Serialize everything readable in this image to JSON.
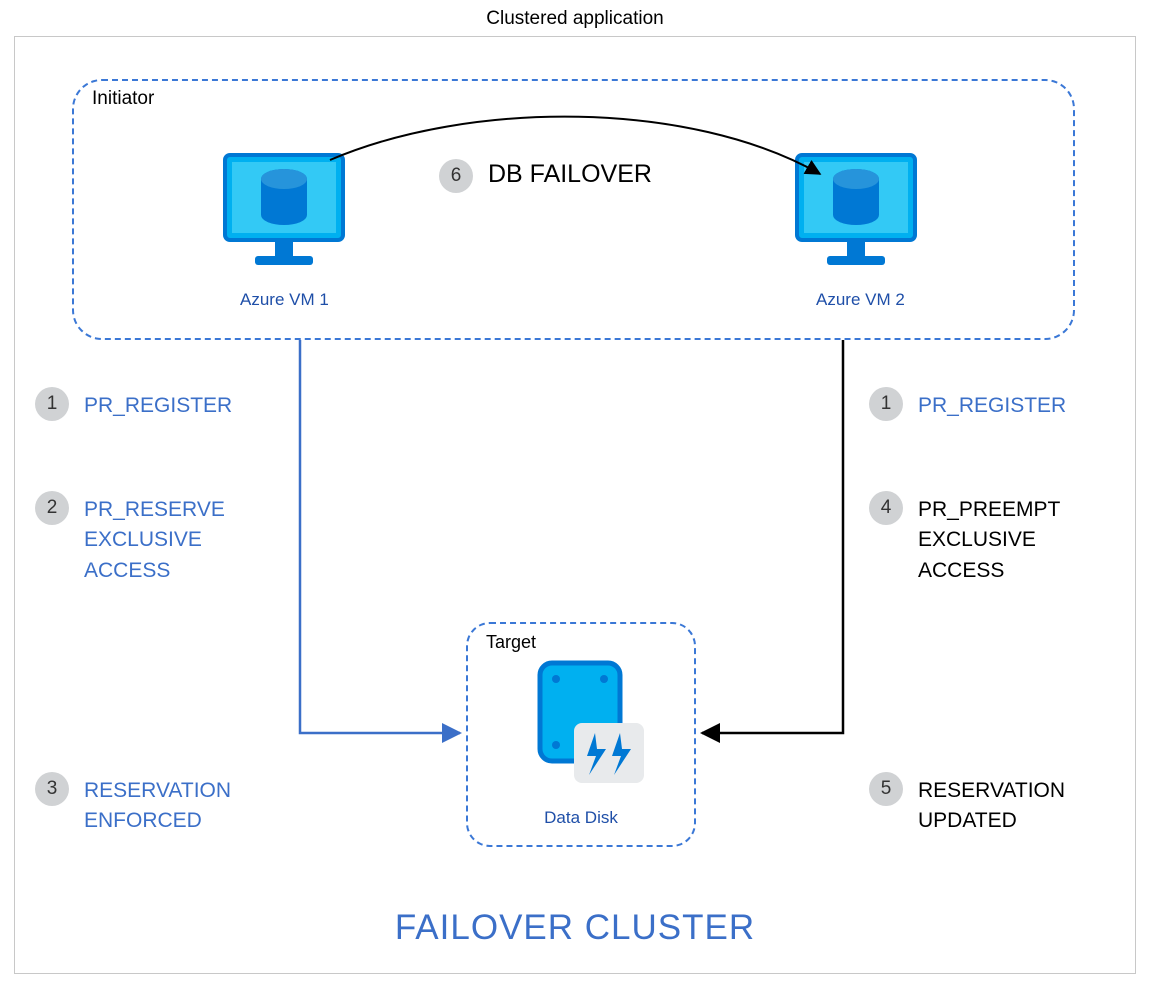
{
  "title": "Clustered application",
  "initiator_label": "Initiator",
  "target_label": "Target",
  "footer": "FAILOVER CLUSTER",
  "vm1_label": "Azure VM 1",
  "vm2_label": "Azure VM 2",
  "data_disk_label": "Data Disk",
  "db_failover_label": "DB FAILOVER",
  "steps": {
    "left1": {
      "num": "1",
      "text": "PR_REGISTER"
    },
    "left2": {
      "num": "2",
      "text": "PR_RESERVE\nEXCLUSIVE\nACCESS"
    },
    "left3": {
      "num": "3",
      "text": "RESERVATION\nENFORCED"
    },
    "right1": {
      "num": "1",
      "text": "PR_REGISTER"
    },
    "right4": {
      "num": "4",
      "text": "PR_PREEMPT\nEXCLUSIVE\nACCESS"
    },
    "right5": {
      "num": "5",
      "text": "RESERVATION\nUPDATED"
    },
    "top6": {
      "num": "6"
    }
  },
  "colors": {
    "azure_blue": "#00b0f0",
    "azure_stroke": "#0078d4",
    "step_blue": "#3b6fc8",
    "badge_bg": "#d0d2d4",
    "dashed": "#3b78d6"
  }
}
